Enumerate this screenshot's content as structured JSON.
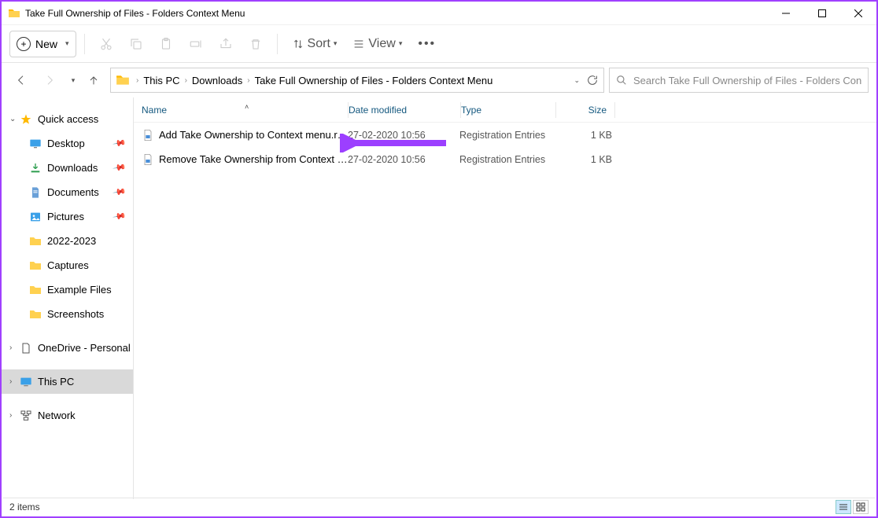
{
  "title": "Take Full Ownership of Files - Folders Context Menu",
  "toolbar": {
    "new_label": "New",
    "sort_label": "Sort",
    "view_label": "View"
  },
  "breadcrumb": {
    "parts": [
      "This PC",
      "Downloads",
      "Take Full Ownership of Files - Folders Context Menu"
    ]
  },
  "search": {
    "placeholder": "Search Take Full Ownership of Files - Folders Context M..."
  },
  "sidebar": {
    "quick_access": "Quick access",
    "items": [
      {
        "label": "Desktop"
      },
      {
        "label": "Downloads"
      },
      {
        "label": "Documents"
      },
      {
        "label": "Pictures"
      },
      {
        "label": "2022-2023"
      },
      {
        "label": "Captures"
      },
      {
        "label": "Example Files"
      },
      {
        "label": "Screenshots"
      }
    ],
    "onedrive": "OneDrive - Personal",
    "thispc": "This PC",
    "network": "Network"
  },
  "columns": {
    "name": "Name",
    "date": "Date modified",
    "type": "Type",
    "size": "Size"
  },
  "files": [
    {
      "name": "Add Take Ownership to Context menu.reg",
      "date": "27-02-2020 10:56",
      "type": "Registration Entries",
      "size": "1 KB"
    },
    {
      "name": "Remove Take Ownership from Context M...",
      "date": "27-02-2020 10:56",
      "type": "Registration Entries",
      "size": "1 KB"
    }
  ],
  "status": "2 items"
}
